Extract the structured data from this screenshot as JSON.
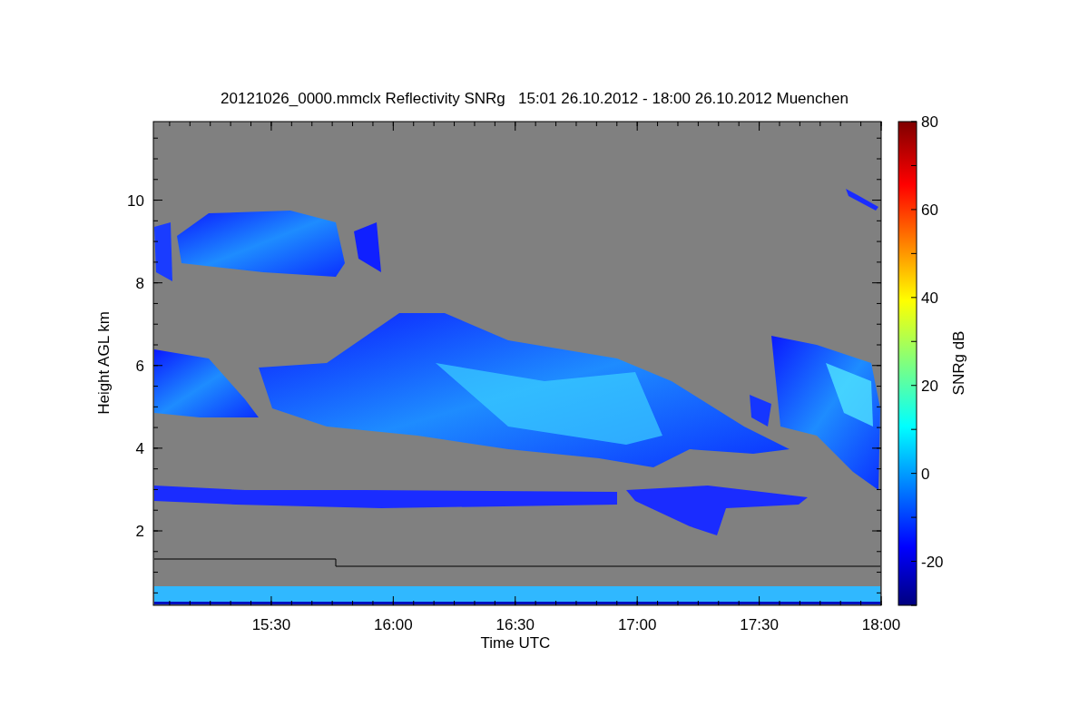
{
  "plot": {
    "title": "20121026_0000.mmclx Reflectivity SNRg   15:01 26.10.2012 - 18:00 26.10.2012 Muenchen",
    "ylabel": "Height AGL km",
    "xlabel": "Time UTC",
    "yticks": [
      "10",
      "8",
      "6",
      "4",
      "2"
    ],
    "xticks": [
      "15:30",
      "16:00",
      "16:30",
      "17:00",
      "17:30",
      "18:00"
    ]
  },
  "colorbar": {
    "label": "SNRg dB",
    "ticks": [
      "80",
      "60",
      "40",
      "20",
      "0",
      "-20"
    ]
  }
}
